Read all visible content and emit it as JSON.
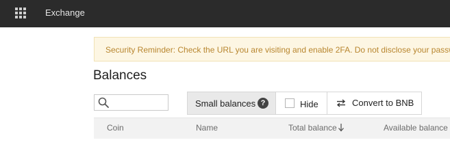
{
  "header": {
    "apps_icon": "grid-icon",
    "brand": "Exchange"
  },
  "notice": {
    "text": "Security Reminder: Check the URL you are visiting and enable 2FA. Do not disclose your password or ma"
  },
  "page": {
    "title": "Balances"
  },
  "search": {
    "placeholder": "",
    "value": ""
  },
  "filters": {
    "small_balances_label": "Small balances",
    "help_icon_glyph": "?",
    "hide_label": "Hide",
    "hide_checked": false,
    "convert_label": "Convert to BNB"
  },
  "table": {
    "columns": [
      "Coin",
      "Name",
      "Total balance",
      "Available balance"
    ],
    "sorted_column": "Total balance",
    "sort_direction": "descending"
  },
  "colors": {
    "topbar": "#2b2b2b",
    "notice_bg": "#fdf6e3",
    "notice_text": "#b8862f",
    "table_header_bg": "#f2f2f2"
  }
}
